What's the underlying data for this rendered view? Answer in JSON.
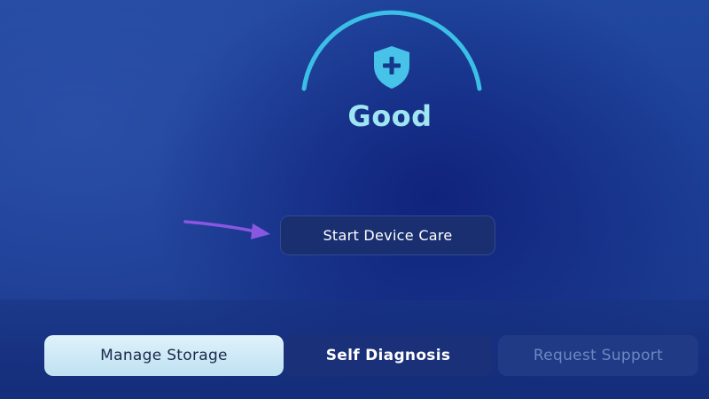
{
  "device_care": {
    "status": "Good",
    "start_button_label": "Start Device Care"
  },
  "tabs": [
    {
      "label": "Manage Storage",
      "selected": true
    },
    {
      "label": "Self Diagnosis",
      "selected": false
    },
    {
      "label": "Request Support",
      "selected": false,
      "disabled": true
    }
  ],
  "icons": {
    "status": "shield-plus-icon",
    "pointer": "arrow-right-icon"
  },
  "colors": {
    "background": "#1e4199",
    "gauge_arc": "#3bbfe6",
    "status_text": "#9fe6f2",
    "selected_tab": "#d4ecf7",
    "annotation_arrow": "#8a57e0"
  }
}
